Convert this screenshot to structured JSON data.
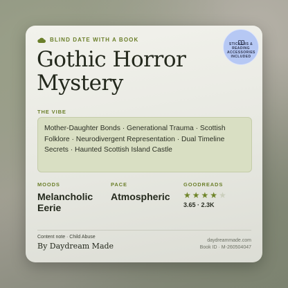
{
  "card": {
    "eyebrow": "BLIND DATE WITH A BOOK",
    "title_line1": "Gothic Horror",
    "title_line2": "Mystery",
    "badge": [
      "STICKERS &",
      "READING",
      "ACCESSORIES",
      "INCLUDED"
    ],
    "vibe_label": "THE VIBE",
    "vibe_text": "Mother-Daughter Bonds · Generational Trauma · Scottish Folklore · Neurodivergent Representation · Dual Timeline Secrets · Haunted Scottish Island Castle",
    "moods_label": "MOODS",
    "moods_line1": "Melancholic",
    "moods_line2": "Eerie",
    "pace_label": "PACE",
    "pace_value": "Atmospheric",
    "goodreads_label": "GOODREADS",
    "rating_stars": 4,
    "rating_text": "3.65 · 2.3K",
    "content_note": "Content note · Child Abuse",
    "byline": "By Daydream Made",
    "site": "daydreammade.com",
    "book_id": "Book ID · M-260504047"
  },
  "colors": {
    "accent": "#6b7f2a",
    "badge": "#b6c8f4",
    "vibe_box": "#d9dfc3",
    "star": "#6e8428"
  },
  "icons": [
    "cloud-icon",
    "book-icon",
    "star-icon"
  ]
}
